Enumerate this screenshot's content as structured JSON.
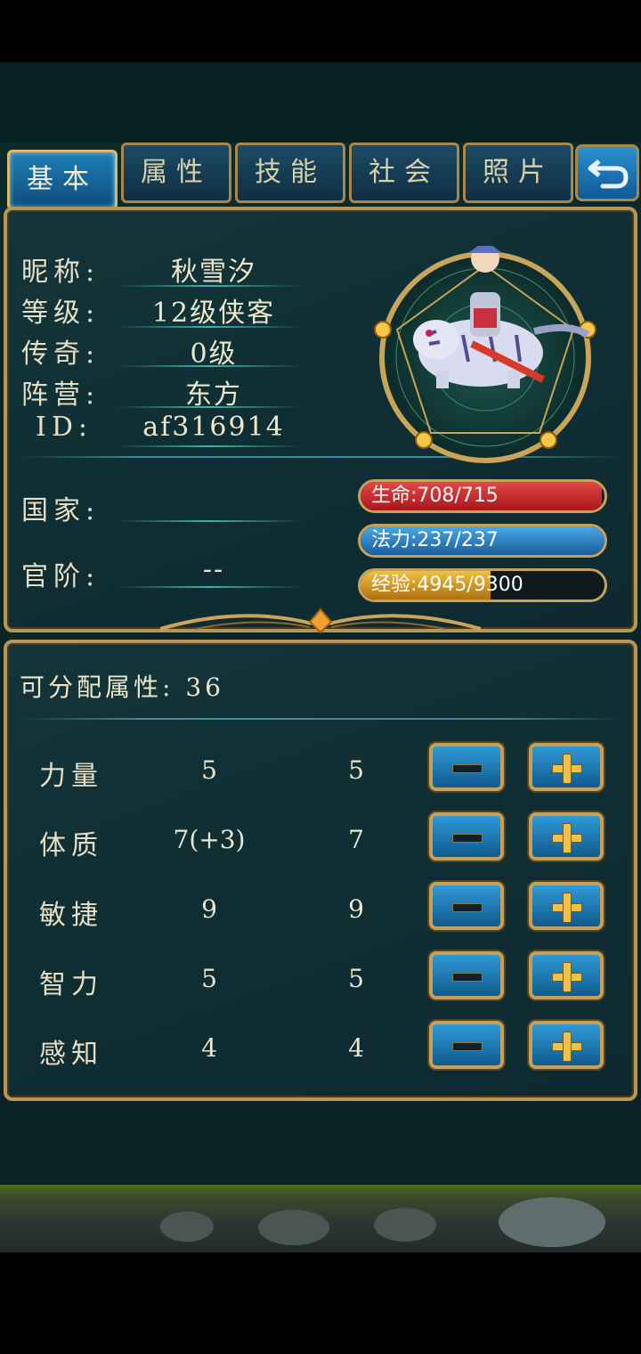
{
  "tabs": [
    {
      "label": "基本",
      "active": true
    },
    {
      "label": "属性",
      "active": false
    },
    {
      "label": "技能",
      "active": false
    },
    {
      "label": "社会",
      "active": false
    },
    {
      "label": "照片",
      "active": false
    }
  ],
  "back_icon": "return-arrow-icon",
  "profile": {
    "nickname_label": "昵称:",
    "nickname": "秋雪汐",
    "level_label": "等级:",
    "level": "12级侠客",
    "legend_label": "传奇:",
    "legend": "0级",
    "camp_label": "阵营:",
    "camp": "东方",
    "id_label": "ID:",
    "id": "af316914",
    "country_label": "国家:",
    "country": "",
    "rank_label": "官阶:",
    "rank": "--"
  },
  "bars": {
    "hp": {
      "text": "生命:708/715",
      "current": 708,
      "max": 715,
      "color": "#c8282c"
    },
    "mp": {
      "text": "法力:237/237",
      "current": 237,
      "max": 237,
      "color": "#2c86c8"
    },
    "exp": {
      "text": "经验:4945/9300",
      "current": 4945,
      "max": 9300,
      "color": "#d8a028"
    }
  },
  "points": {
    "text": "可分配属性: 36"
  },
  "stats": [
    {
      "name": "力量",
      "base": "5",
      "current": "5"
    },
    {
      "name": "体质",
      "base": "7(+3)",
      "current": "7"
    },
    {
      "name": "敏捷",
      "base": "9",
      "current": "9"
    },
    {
      "name": "智力",
      "base": "5",
      "current": "5"
    },
    {
      "name": "感知",
      "base": "4",
      "current": "4"
    }
  ],
  "colors": {
    "accent": "#b69656",
    "panel": "#0f2e33",
    "active_tab": "#1f7fb6"
  }
}
